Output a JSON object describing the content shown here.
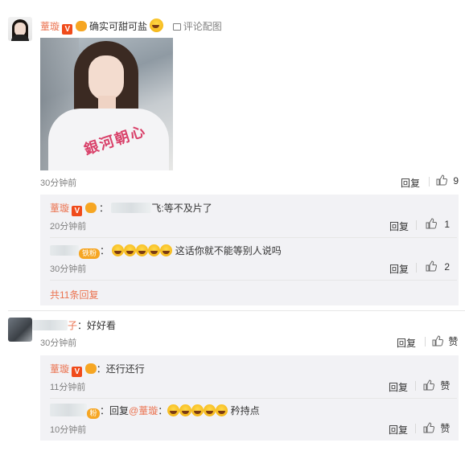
{
  "comment1": {
    "username": "蕫璇",
    "text": "确实可甜可盐",
    "image_link": "评论配图",
    "photo_print": "銀河朝心",
    "time": "30分钟前",
    "reply_label": "回复",
    "like_count": "9"
  },
  "comment1_replies": [
    {
      "username": "蕫璇",
      "blur_suffix": "飞",
      "text": ":等不及片了",
      "time": "20分钟前",
      "reply_label": "回复",
      "like_count": "1"
    },
    {
      "badge": "铁粉",
      "text": "这话你就不能等别人说吗",
      "time": "30分钟前",
      "reply_label": "回复",
      "like_count": "2"
    }
  ],
  "comment1_more": "共11条回复",
  "comment2": {
    "name_suffix": "子",
    "text": "：好好看",
    "time": "30分钟前",
    "reply_label": "回复",
    "like_label": "赞"
  },
  "comment2_replies": [
    {
      "username": "蕫璇",
      "text": "：还行还行",
      "time": "11分钟前",
      "reply_label": "回复",
      "like_label": "赞"
    },
    {
      "badge": "粉",
      "prefix": "：回复",
      "mention": "@蕫璇",
      "text": "矜持点",
      "time": "10分钟前",
      "reply_label": "回复",
      "like_label": "赞"
    }
  ],
  "icons": {
    "verified": "V",
    "image": "image-icon",
    "thumb": "thumb-up-icon",
    "emoji": "laugh-cry-emoji"
  },
  "colors": {
    "accent": "#eb7350",
    "reply_bg": "#f2f2f5"
  }
}
